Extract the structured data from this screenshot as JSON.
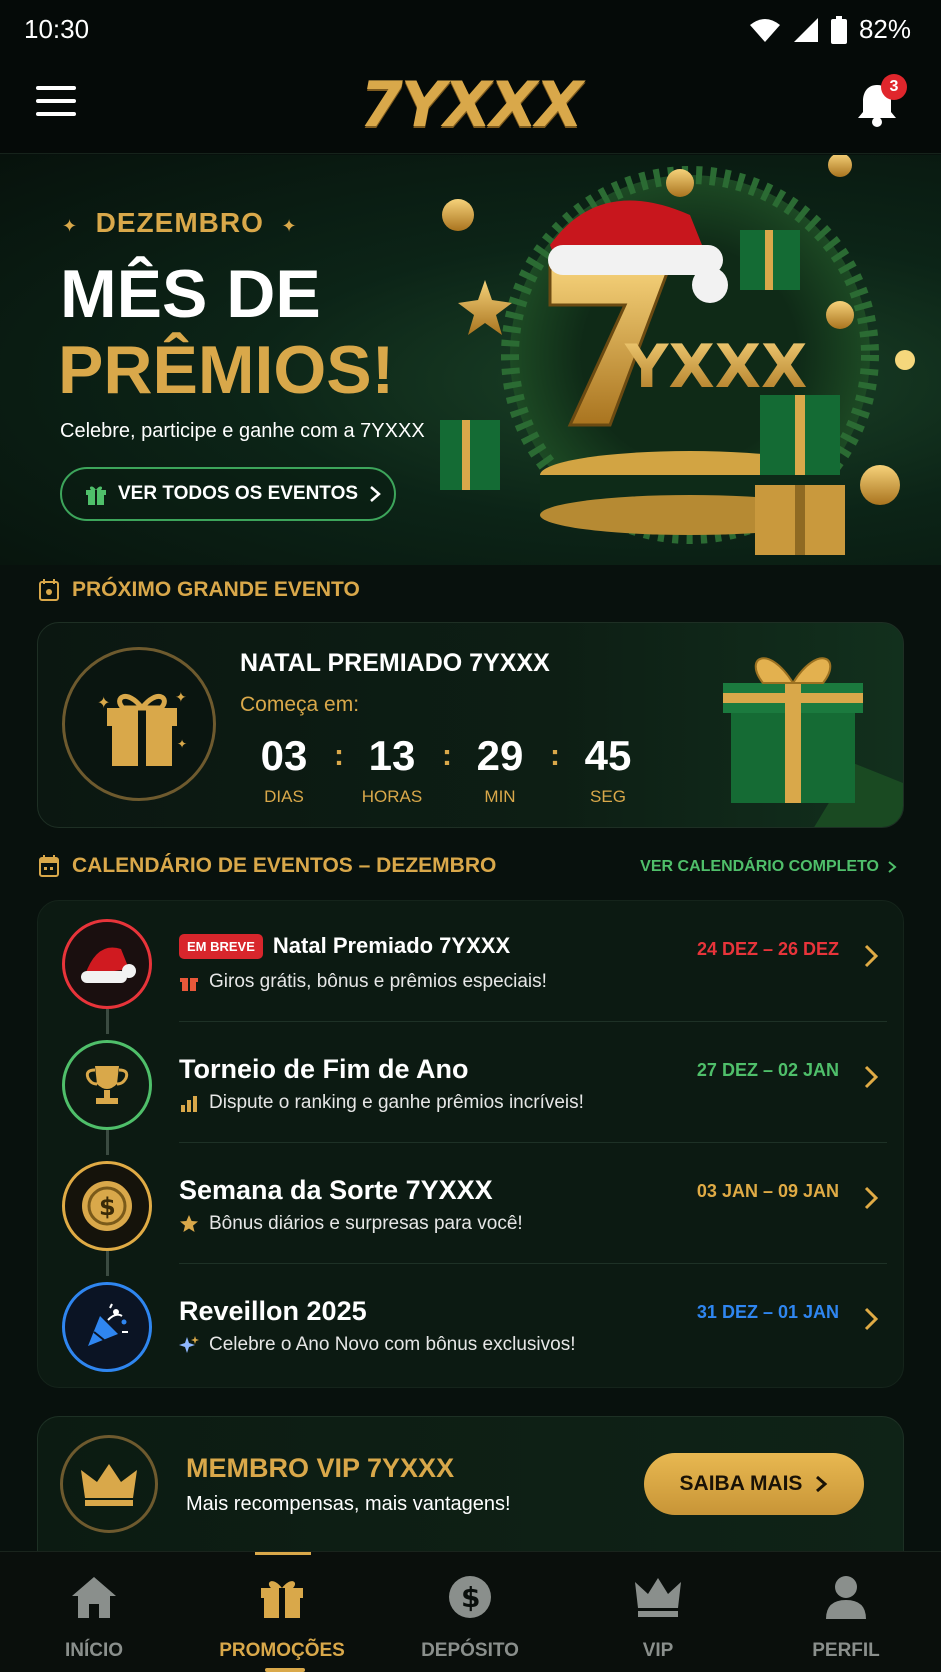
{
  "status_bar": {
    "time": "10:30",
    "battery": "82%"
  },
  "app_bar": {
    "logo": "7YXXX",
    "notification_count": "3"
  },
  "hero": {
    "kicker": "DEZEMBRO",
    "title_line1": "MÊS DE",
    "title_line2": "PRÊMIOS!",
    "subtitle": "Celebre, participe e ganhe com a 7YXXX",
    "button_label": "VER TODOS OS EVENTOS",
    "art_logo": "YXXX"
  },
  "next_event": {
    "heading": "PRÓXIMO GRANDE EVENTO",
    "name": "NATAL PREMIADO 7YXXX",
    "starts_label": "Começa em:",
    "countdown": [
      {
        "value": "03",
        "label": "DIAS"
      },
      {
        "value": "13",
        "label": "HORAS"
      },
      {
        "value": "29",
        "label": "MIN"
      },
      {
        "value": "45",
        "label": "SEG"
      }
    ]
  },
  "calendar": {
    "heading": "CALENDÁRIO DE EVENTOS – DEZEMBRO",
    "link_label": "VER CALENDÁRIO COMPLETO",
    "events": [
      {
        "badge": "EM BREVE",
        "title": "Natal Premiado 7YXXX",
        "desc": "Giros grátis, bônus e prêmios especiais!",
        "date": "24 DEZ – 26 DEZ",
        "color": "#e8343a",
        "icon": "santa-hat-icon"
      },
      {
        "badge": "",
        "title": "Torneio de Fim de Ano",
        "desc": "Dispute o ranking e ganhe prêmios incríveis!",
        "date": "27 DEZ – 02 JAN",
        "color": "#4fbf6a",
        "icon": "trophy-icon"
      },
      {
        "badge": "",
        "title": "Semana da Sorte 7YXXX",
        "desc": "Bônus diários e surpresas para você!",
        "date": "03 JAN – 09 JAN",
        "color": "#e0ab45",
        "icon": "coin-icon"
      },
      {
        "badge": "",
        "title": "Reveillon 2025",
        "desc": "Celebre o Ano Novo com bônus exclusivos!",
        "date": "31 DEZ – 01 JAN",
        "color": "#2f86f0",
        "icon": "party-popper-icon"
      }
    ]
  },
  "vip": {
    "title": "MEMBRO VIP 7YXXX",
    "subtitle": "Mais recompensas, mais vantagens!",
    "button_label": "SAIBA MAIS"
  },
  "bottom_nav": [
    {
      "label": "INÍCIO",
      "icon": "home-icon",
      "active": false
    },
    {
      "label": "PROMOÇÕES",
      "icon": "gift-icon",
      "active": true
    },
    {
      "label": "DEPÓSITO",
      "icon": "dollar-icon",
      "active": false
    },
    {
      "label": "VIP",
      "icon": "crown-icon",
      "active": false
    },
    {
      "label": "PERFIL",
      "icon": "user-icon",
      "active": false
    }
  ],
  "colors": {
    "gold": "#d9a84a",
    "green": "#4fbf6a",
    "red": "#e8343a",
    "blue": "#2f86f0",
    "background": "#08110d"
  }
}
